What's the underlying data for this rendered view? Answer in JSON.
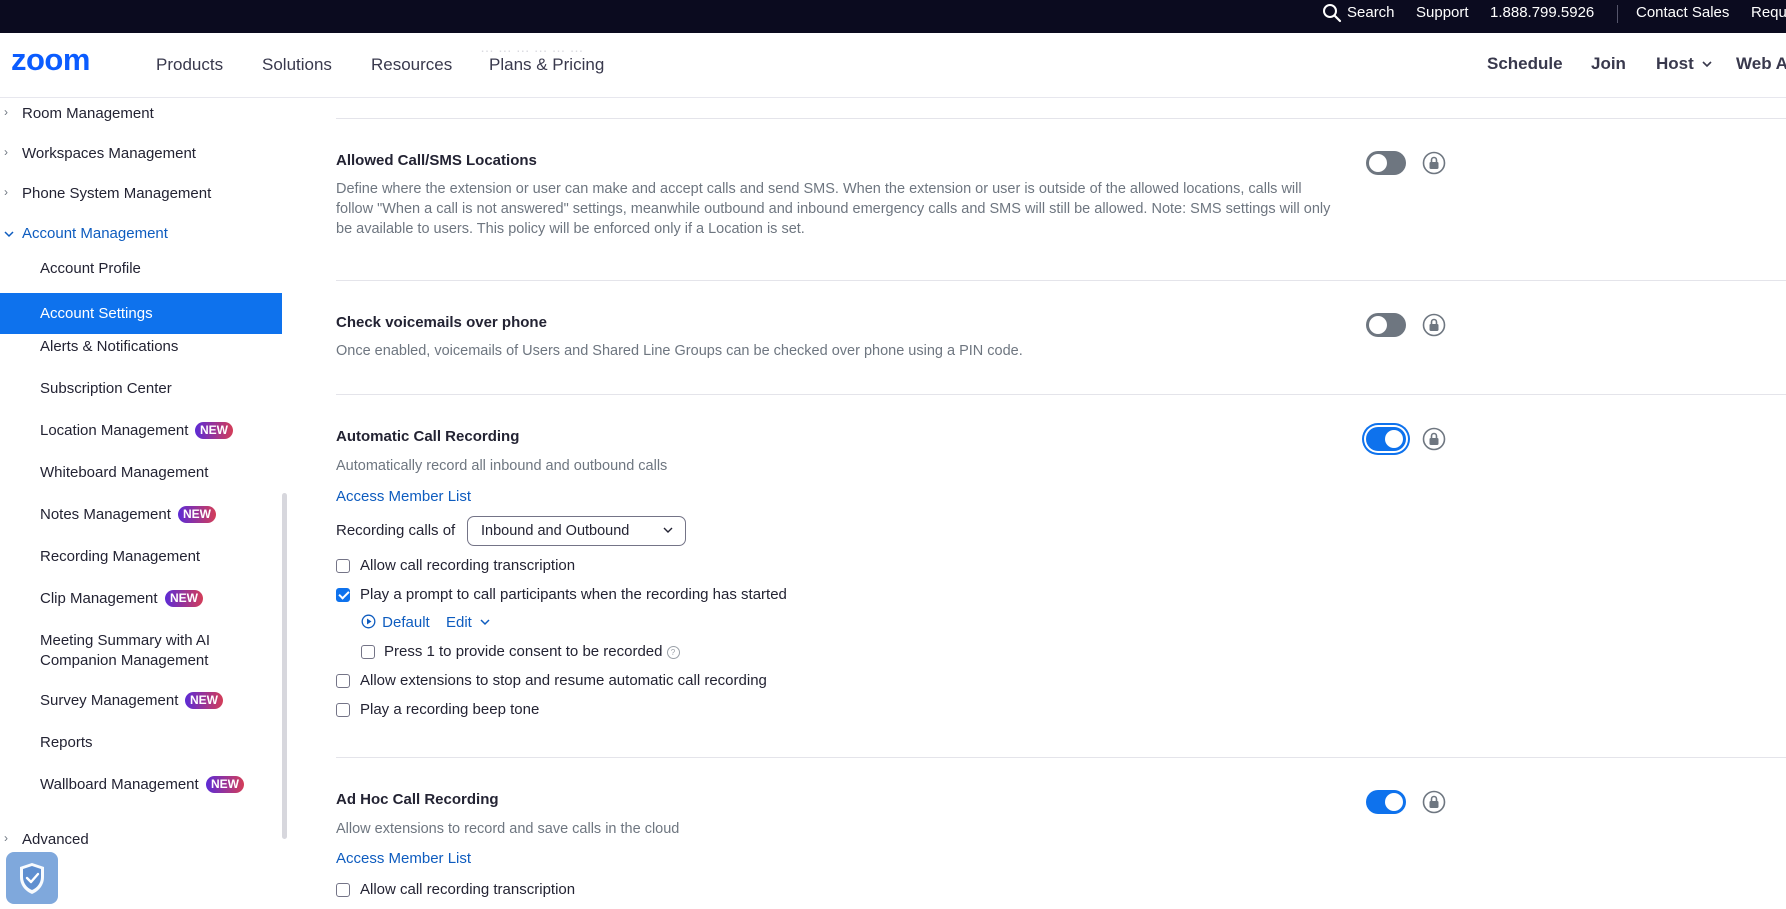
{
  "topbar": {
    "search": "Search",
    "support": "Support",
    "phone": "1.888.799.5926",
    "contact_sales": "Contact Sales",
    "request": "Requ"
  },
  "nav": {
    "logo": "zoom",
    "faint_text": "… … … … … …",
    "products": "Products",
    "solutions": "Solutions",
    "resources": "Resources",
    "plans": "Plans & Pricing",
    "schedule": "Schedule",
    "join": "Join",
    "host": "Host",
    "web": "Web A"
  },
  "sidebar": {
    "room": "Room Management",
    "workspaces": "Workspaces Management",
    "phone": "Phone System Management",
    "account": "Account Management",
    "items": [
      {
        "label": "Account Profile",
        "new": false
      },
      {
        "label": "Account Settings",
        "new": false
      },
      {
        "label": "Alerts & Notifications",
        "new": false
      },
      {
        "label": "Subscription Center",
        "new": false
      },
      {
        "label": "Location Management",
        "new": true
      },
      {
        "label": "Whiteboard Management",
        "new": false
      },
      {
        "label": "Notes Management",
        "new": true
      },
      {
        "label": "Recording Management",
        "new": false
      },
      {
        "label": "Clip Management",
        "new": true
      },
      {
        "label": "Meeting Summary with AI",
        "label2": "Companion Management",
        "new": false
      },
      {
        "label": "Survey Management",
        "new": true
      },
      {
        "label": "Reports",
        "new": false
      },
      {
        "label": "Wallboard Management",
        "new": true
      }
    ],
    "new_badge": "NEW",
    "advanced": "Advanced"
  },
  "settings": {
    "allowed": {
      "title": "Allowed Call/SMS Locations",
      "desc": "Define where the extension or user can make and accept calls and send SMS. When the extension or user is outside of the allowed locations, calls will follow \"When a call is not answered\" settings, meanwhile outbound and inbound emergency calls and SMS will still be allowed. Note: SMS settings will only be available to users. This policy will be enforced only if a Location is set.",
      "enabled": false
    },
    "voicemail": {
      "title": "Check voicemails over phone",
      "desc": "Once enabled, voicemails of Users and Shared Line Groups can be checked over phone using a PIN code.",
      "enabled": false
    },
    "auto": {
      "title": "Automatic Call Recording",
      "desc": "Automatically record all inbound and outbound calls",
      "access_link": "Access Member List",
      "recording_calls_label": "Recording calls of",
      "recording_calls_value": "Inbound and Outbound",
      "opt_transcription": "Allow call recording transcription",
      "opt_prompt": "Play a prompt to call participants when the recording has started",
      "default_label": "Default",
      "edit_label": "Edit",
      "opt_press1": "Press 1 to provide consent to be recorded",
      "opt_stop_resume": "Allow extensions to stop and resume automatic call recording",
      "opt_beep": "Play a recording beep tone",
      "enabled": true
    },
    "adhoc": {
      "title": "Ad Hoc Call Recording",
      "desc": "Allow extensions to record and save calls in the cloud",
      "access_link": "Access Member List",
      "opt_transcription": "Allow call recording transcription",
      "enabled": true
    }
  },
  "colors": {
    "accent": "#0e72ed",
    "topbar": "#0b0b1f",
    "toggle_off": "#6e7680",
    "badge_start": "#5c2bd6",
    "badge_end": "#d43d58"
  }
}
